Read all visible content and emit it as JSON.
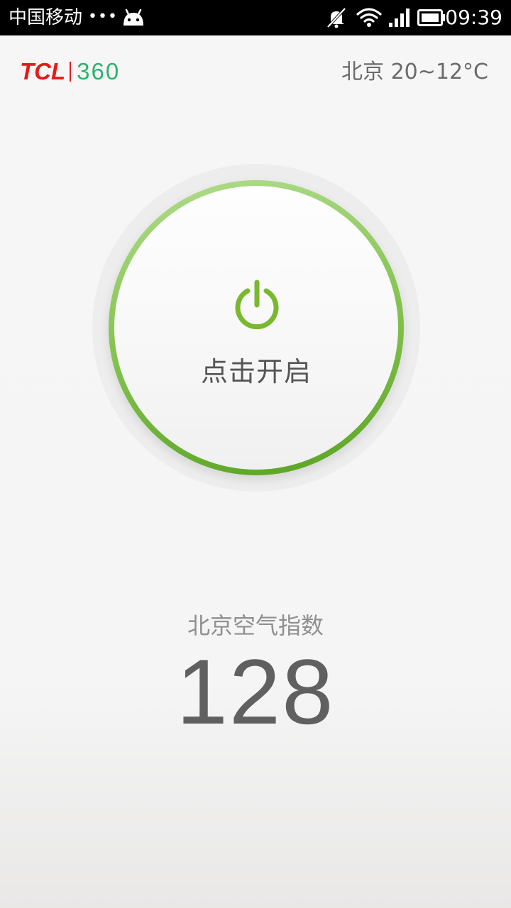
{
  "status_bar": {
    "carrier": "中国移动",
    "dots": "•••",
    "time": "09:39",
    "icons": [
      "android-icon",
      "notification-mute-icon",
      "wifi-icon",
      "signal-icon",
      "battery-icon"
    ]
  },
  "header": {
    "logo_primary": "TCL",
    "logo_secondary": "360",
    "weather": "北京 20~12°C"
  },
  "power": {
    "label": "点击开启",
    "icon": "power-icon"
  },
  "air": {
    "title": "北京空气指数",
    "value": "128"
  },
  "colors": {
    "accent_green": "#7ab82f",
    "logo_red": "#e31b1b",
    "logo_green": "#2bb36a"
  }
}
